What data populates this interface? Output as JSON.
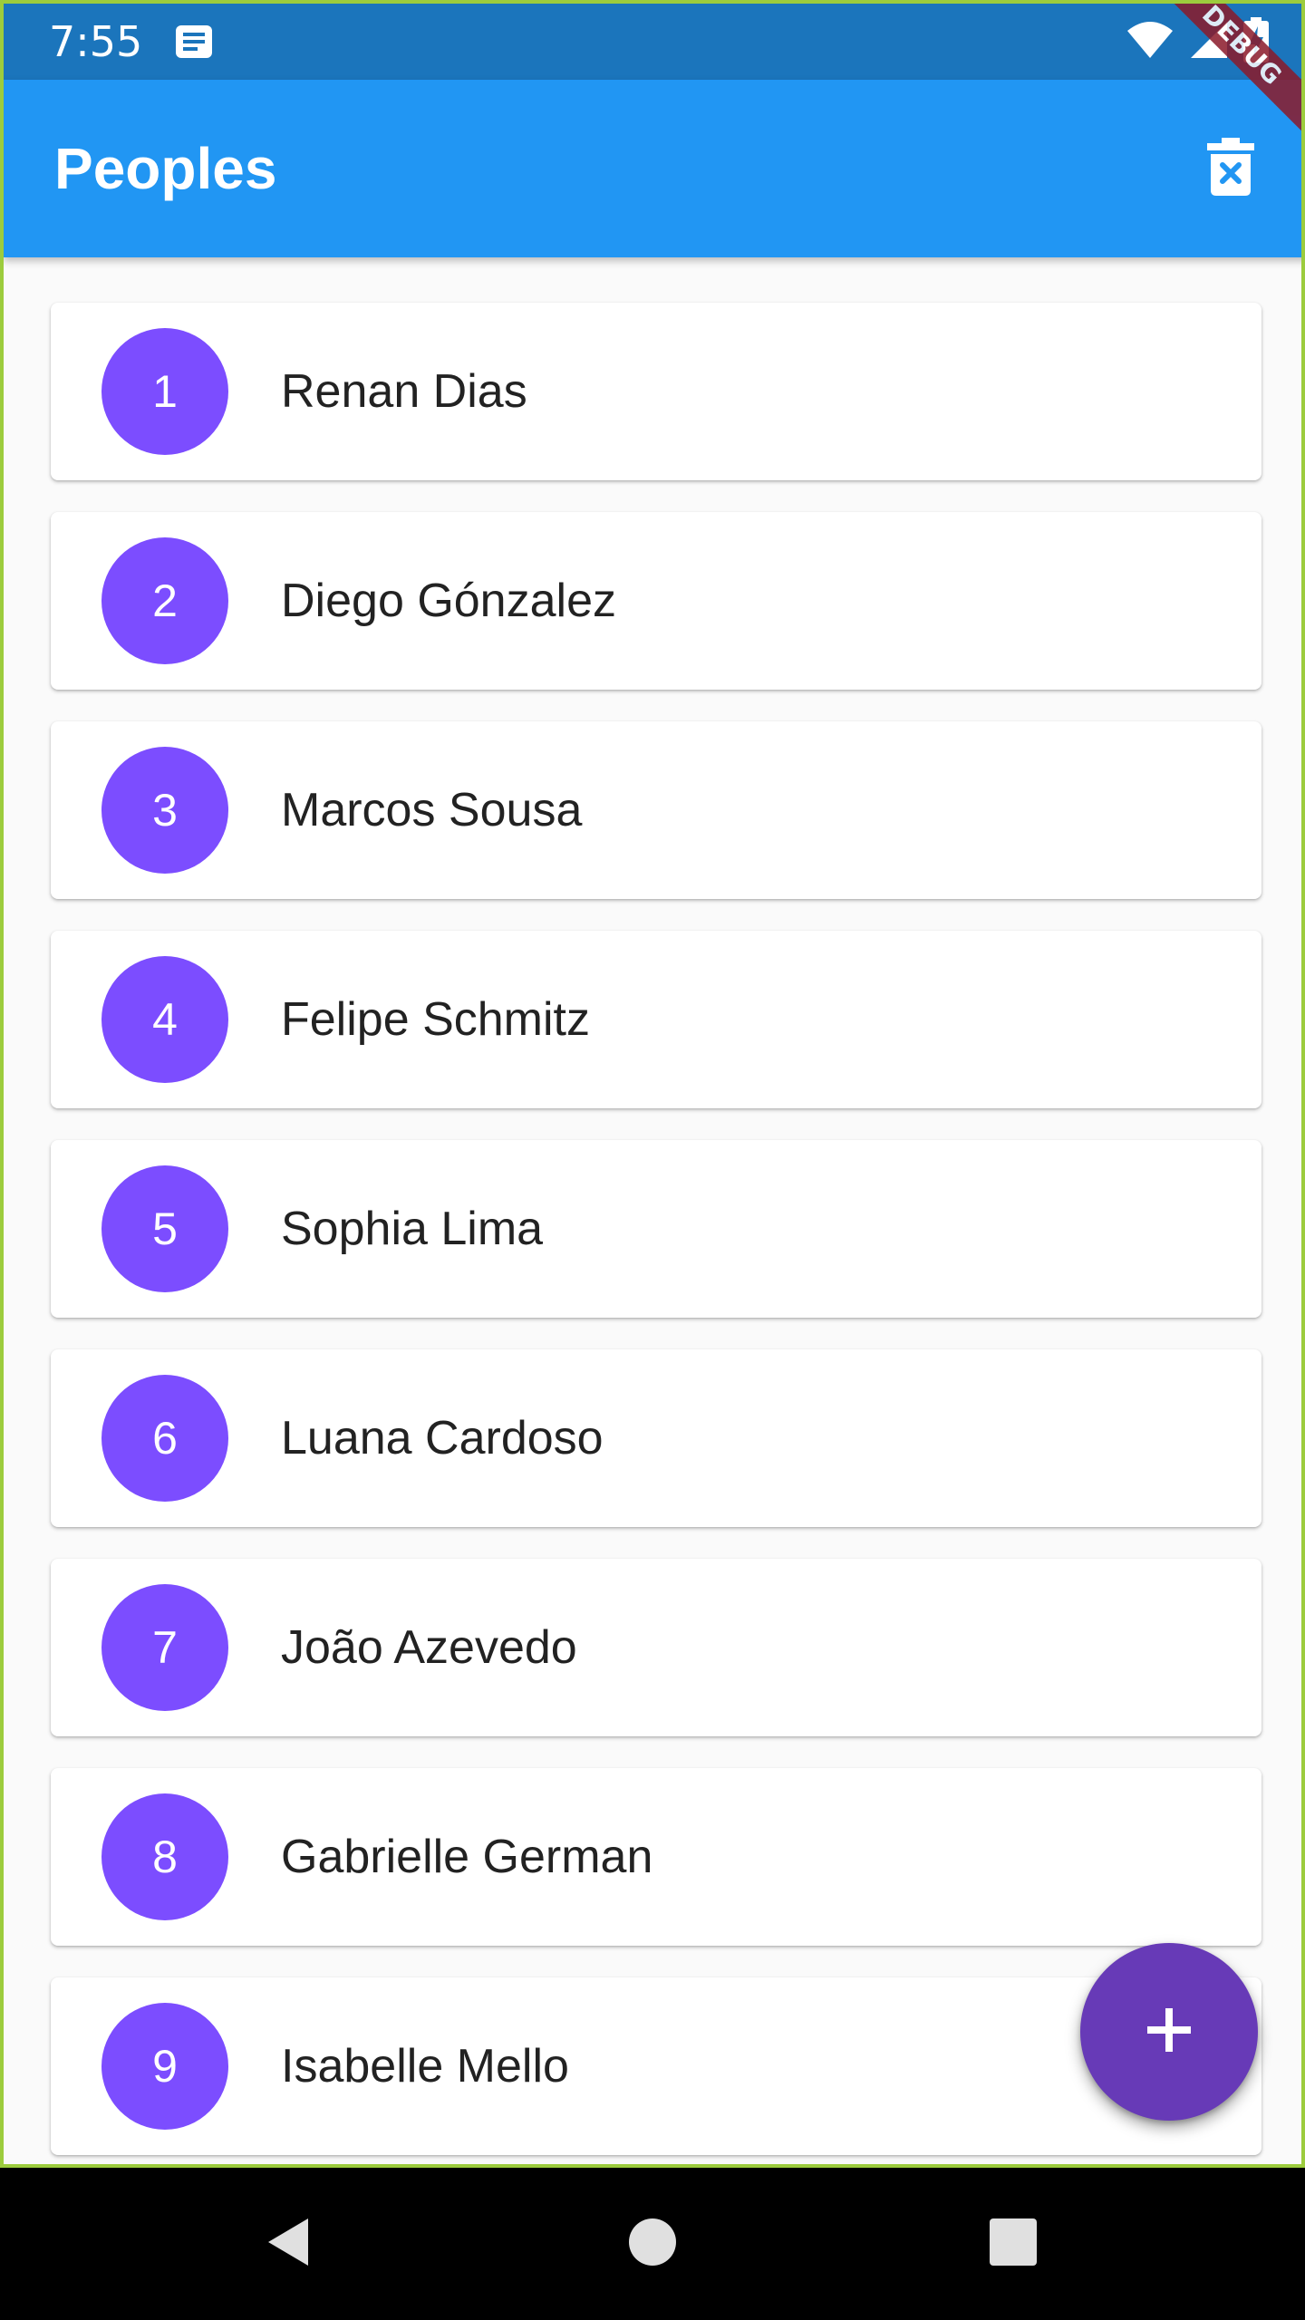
{
  "status_bar": {
    "time": "7:55",
    "icons": [
      "notification-icon",
      "wifi-icon",
      "signal-icon",
      "battery-charging-icon"
    ]
  },
  "debug_banner": "DEBUG",
  "app_bar": {
    "title": "Peoples",
    "action_icon": "delete-sweep-icon"
  },
  "people": [
    {
      "number": "1",
      "name": "Renan Dias"
    },
    {
      "number": "2",
      "name": "Diego Gónzalez"
    },
    {
      "number": "3",
      "name": "Marcos Sousa"
    },
    {
      "number": "4",
      "name": "Felipe Schmitz"
    },
    {
      "number": "5",
      "name": "Sophia Lima"
    },
    {
      "number": "6",
      "name": "Luana Cardoso"
    },
    {
      "number": "7",
      "name": "João Azevedo"
    },
    {
      "number": "8",
      "name": "Gabrielle German"
    },
    {
      "number": "9",
      "name": "Isabelle Mello"
    }
  ],
  "fab": {
    "icon": "add-icon"
  },
  "nav": {
    "icons": [
      "back-icon",
      "home-icon",
      "recents-icon"
    ]
  },
  "colors": {
    "status_bar": "#1b75bc",
    "app_bar": "#2196f3",
    "avatar": "#7c4dff",
    "fab": "#673ab7",
    "background": "#fafafa"
  }
}
